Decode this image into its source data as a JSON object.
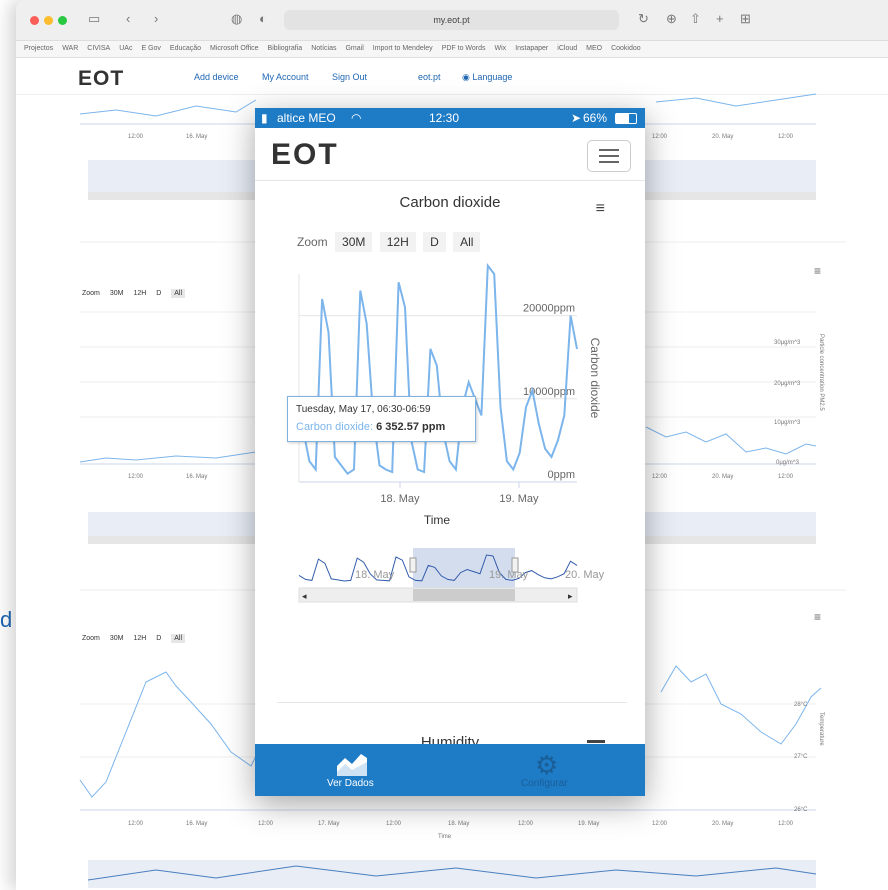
{
  "browser": {
    "url": "my.eot.pt"
  },
  "bookmarks": [
    "Projectos",
    "WAR",
    "CIVISA",
    "UAc",
    "E Gov",
    "Educação",
    "Microsoft Office",
    "Bibliografia",
    "Notícias",
    "Gmail",
    "Import to Mendeley",
    "PDF to Words",
    "Wix",
    "Instapaper",
    "iCloud",
    "MEO",
    "Cookidoo"
  ],
  "site": {
    "logo": "EOT",
    "links": [
      "Add device",
      "My Account",
      "Sign Out",
      "eot.pt",
      "Language"
    ]
  },
  "bg": {
    "zoom": {
      "label": "Zoom",
      "buttons": [
        "30M",
        "12H",
        "D",
        "All"
      ]
    },
    "ticks_top": [
      "12:00",
      "16. May",
      "12:00",
      "20. May",
      "12:00"
    ],
    "ticks_axis": [
      "12:00",
      "16. May",
      "12:00",
      "17. May",
      "12:00",
      "18. May",
      "12:00",
      "19. May",
      "12:00",
      "20. May",
      "12:00"
    ],
    "xaxis": "Time",
    "pm_axis": [
      "30µg/m^3",
      "20µg/m^3",
      "10µg/m^3",
      "0µg/m^3"
    ],
    "pm_title": "Particle concentration PM2.5",
    "temp_axis": [
      "28°C",
      "27°C",
      "26°C"
    ],
    "temp_title": "Temperature",
    "side_letter": "d"
  },
  "phone": {
    "status": {
      "carrier": "altice MEO",
      "time": "12:30",
      "battery": "66%"
    },
    "logo": "EOT",
    "chart_title": "Carbon dioxide",
    "zoom": {
      "label": "Zoom",
      "buttons": [
        "30M",
        "12H",
        "D",
        "All"
      ]
    },
    "tooltip": {
      "date": "Tuesday, May 17, 06:30-06:59",
      "series": "Carbon dioxide:",
      "value": "6 352.57 ppm"
    },
    "next_title": "Humidity",
    "tabs": {
      "left": "Ver Dados",
      "right": "Configurar"
    }
  },
  "chart_data": {
    "type": "line",
    "title": "Carbon dioxide",
    "xlabel": "Time",
    "ylabel": "Carbon dioxide",
    "x_ticks": [
      "18. May",
      "19. May"
    ],
    "y_ticks": [
      "0ppm",
      "10000ppm",
      "20000ppm"
    ],
    "ylim": [
      0,
      25000
    ],
    "navigator_ticks": [
      "18. May",
      "19. May",
      "20. May"
    ],
    "series": [
      {
        "name": "Carbon dioxide",
        "values": [
          6352,
          2500,
          1500,
          22000,
          18000,
          3000,
          2000,
          1000,
          1500,
          23000,
          19000,
          8000,
          2000,
          1500,
          1200,
          24000,
          21000,
          5000,
          1500,
          1200,
          16000,
          14000,
          6000,
          2500,
          1500,
          9000,
          12000,
          10000,
          8000,
          26000,
          25000,
          9000,
          2500,
          1500,
          3500,
          9000,
          11000,
          7000,
          4000,
          3000,
          5000,
          8000,
          20000,
          16000
        ]
      }
    ]
  }
}
